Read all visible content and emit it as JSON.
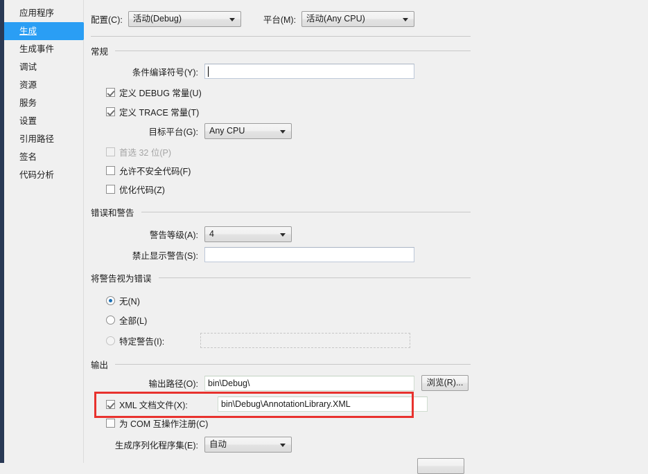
{
  "sidebar": {
    "items": [
      {
        "label": "应用程序",
        "selected": false
      },
      {
        "label": "生成",
        "selected": true
      },
      {
        "label": "生成事件",
        "selected": false
      },
      {
        "label": "调试",
        "selected": false
      },
      {
        "label": "资源",
        "selected": false
      },
      {
        "label": "服务",
        "selected": false
      },
      {
        "label": "设置",
        "selected": false
      },
      {
        "label": "引用路径",
        "selected": false
      },
      {
        "label": "签名",
        "selected": false
      },
      {
        "label": "代码分析",
        "selected": false
      }
    ]
  },
  "toolbar": {
    "configuration_label": "配置(C):",
    "configuration_value": "活动(Debug)",
    "platform_label": "平台(M):",
    "platform_value": "活动(Any CPU)"
  },
  "general": {
    "heading": "常规",
    "conditional_symbols_label": "条件编译符号(Y):",
    "conditional_symbols_value": "",
    "define_debug_label": "定义 DEBUG 常量(U)",
    "define_debug_checked": true,
    "define_trace_label": "定义 TRACE 常量(T)",
    "define_trace_checked": true,
    "target_platform_label": "目标平台(G):",
    "target_platform_value": "Any CPU",
    "prefer32_label": "首选 32 位(P)",
    "prefer32_checked": false,
    "unsafe_label": "允许不安全代码(F)",
    "unsafe_checked": false,
    "optimize_label": "优化代码(Z)",
    "optimize_checked": false
  },
  "errors_warnings": {
    "heading": "错误和警告",
    "warning_level_label": "警告等级(A):",
    "warning_level_value": "4",
    "suppress_warnings_label": "禁止显示警告(S):",
    "suppress_warnings_value": ""
  },
  "treat_warnings": {
    "heading": "将警告视为错误",
    "none_label": "无(N)",
    "all_label": "全部(L)",
    "specific_label": "特定警告(I):",
    "specific_value": "",
    "selected": "none"
  },
  "output": {
    "heading": "输出",
    "output_path_label": "输出路径(O):",
    "output_path_value": "bin\\Debug\\",
    "browse_label": "浏览(R)...",
    "xml_doc_label": "XML 文档文件(X):",
    "xml_doc_checked": true,
    "xml_doc_value": "bin\\Debug\\AnnotationLibrary.XML",
    "com_interop_label": "为 COM 互操作注册(C)",
    "com_interop_checked": false,
    "serialization_label": "生成序列化程序集(E):",
    "serialization_value": "自动"
  },
  "annotation": {
    "color": "#e8322e"
  }
}
